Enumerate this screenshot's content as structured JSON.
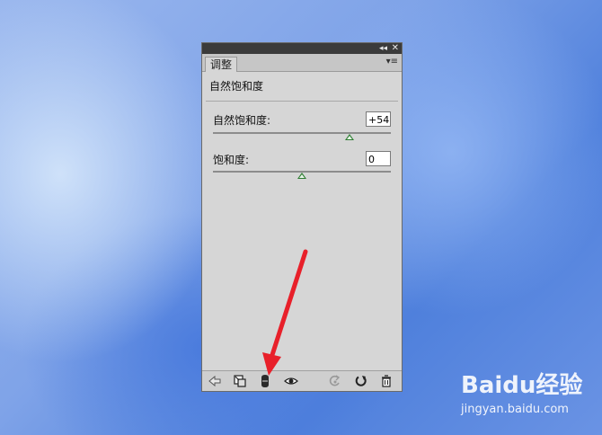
{
  "panel": {
    "tab_label": "调整",
    "section_title": "自然饱和度",
    "vibrance": {
      "label": "自然饱和度:",
      "value": "+54",
      "fraction": 0.77
    },
    "saturation": {
      "label": "饱和度:",
      "value": "0",
      "fraction": 0.5
    }
  },
  "bottom_icons": [
    "back-arrow-icon",
    "expand-view-icon",
    "clip-to-layer-icon",
    "visibility-eye-icon",
    "previous-state-icon",
    "reset-icon",
    "trash-icon"
  ],
  "watermark": {
    "brand": "Baidu经验",
    "url": "jingyan.baidu.com"
  },
  "colors": {
    "slider_thumb": "#2e7d32",
    "arrow": "#e8202a",
    "titlebar": "#3b3b3b"
  }
}
